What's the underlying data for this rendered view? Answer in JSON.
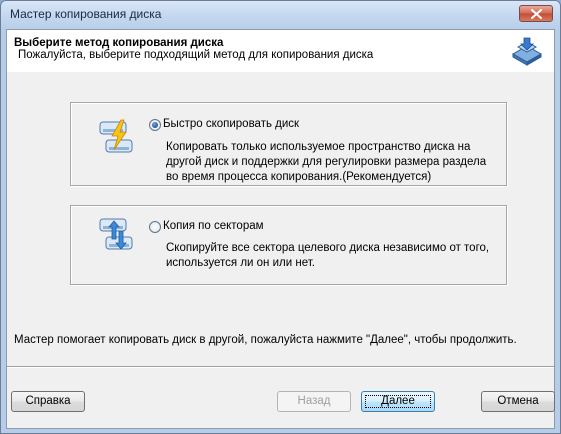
{
  "window": {
    "title": "Мастер копирования диска"
  },
  "header": {
    "title": "Выберите метод копирования диска",
    "subtitle": "Пожалуйста, выберите подходящий метод для копирования диска",
    "icon": "disk-copy-icon"
  },
  "options": [
    {
      "label": "Быстро скопировать диск",
      "checked": true,
      "icon": "quick-copy-disk-icon",
      "description_lines": [
        "Копировать только используемое пространство диска на",
        "другой диск и поддержки для регулировки размера раздела",
        "во время процесса копирования.(Рекомендуется)"
      ]
    },
    {
      "label": "Копия по секторам",
      "checked": false,
      "icon": "sector-copy-disk-icon",
      "description_lines": [
        "Скопируйте все сектора целевого диска независимо от того,",
        "используется ли он или нет."
      ]
    }
  ],
  "footer": {
    "text": "Мастер помогает копировать диск в другой, пожалуйста нажмите \"Далее\", чтобы продолжить."
  },
  "buttons": {
    "help": "Справка",
    "back": "Назад",
    "next": "Далее",
    "cancel": "Отмена"
  },
  "colors": {
    "accent": "#3c7fb1",
    "close": "#c24e37",
    "dialog_bg": "#f0f0f0"
  }
}
